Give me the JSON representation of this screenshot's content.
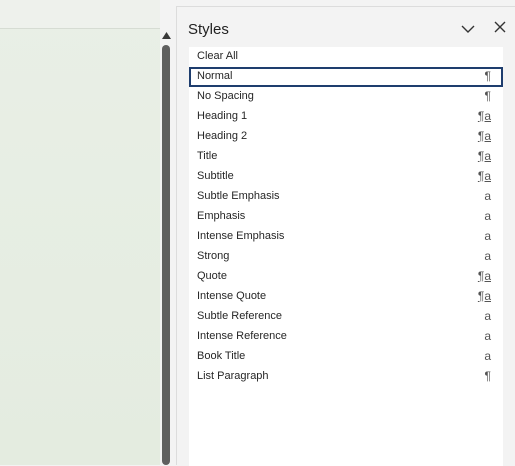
{
  "pane": {
    "title": "Styles"
  },
  "styles": [
    {
      "label": "Clear All",
      "symbol": ""
    },
    {
      "label": "Normal",
      "symbol": "¶",
      "selected": true
    },
    {
      "label": "No Spacing",
      "symbol": "¶"
    },
    {
      "label": "Heading 1",
      "symbol": "¶a"
    },
    {
      "label": "Heading 2",
      "symbol": "¶a"
    },
    {
      "label": "Title",
      "symbol": "¶a"
    },
    {
      "label": "Subtitle",
      "symbol": "¶a"
    },
    {
      "label": "Subtle Emphasis",
      "symbol": "a"
    },
    {
      "label": "Emphasis",
      "symbol": "a"
    },
    {
      "label": "Intense Emphasis",
      "symbol": "a"
    },
    {
      "label": "Strong",
      "symbol": "a"
    },
    {
      "label": "Quote",
      "symbol": "¶a"
    },
    {
      "label": "Intense Quote",
      "symbol": "¶a"
    },
    {
      "label": "Subtle Reference",
      "symbol": "a"
    },
    {
      "label": "Intense Reference",
      "symbol": "a"
    },
    {
      "label": "Book Title",
      "symbol": "a"
    },
    {
      "label": "List Paragraph",
      "symbol": "¶"
    }
  ],
  "icons": {
    "options": "chevron-down-icon",
    "close": "close-icon",
    "scroll_up": "triangle-up-icon"
  }
}
